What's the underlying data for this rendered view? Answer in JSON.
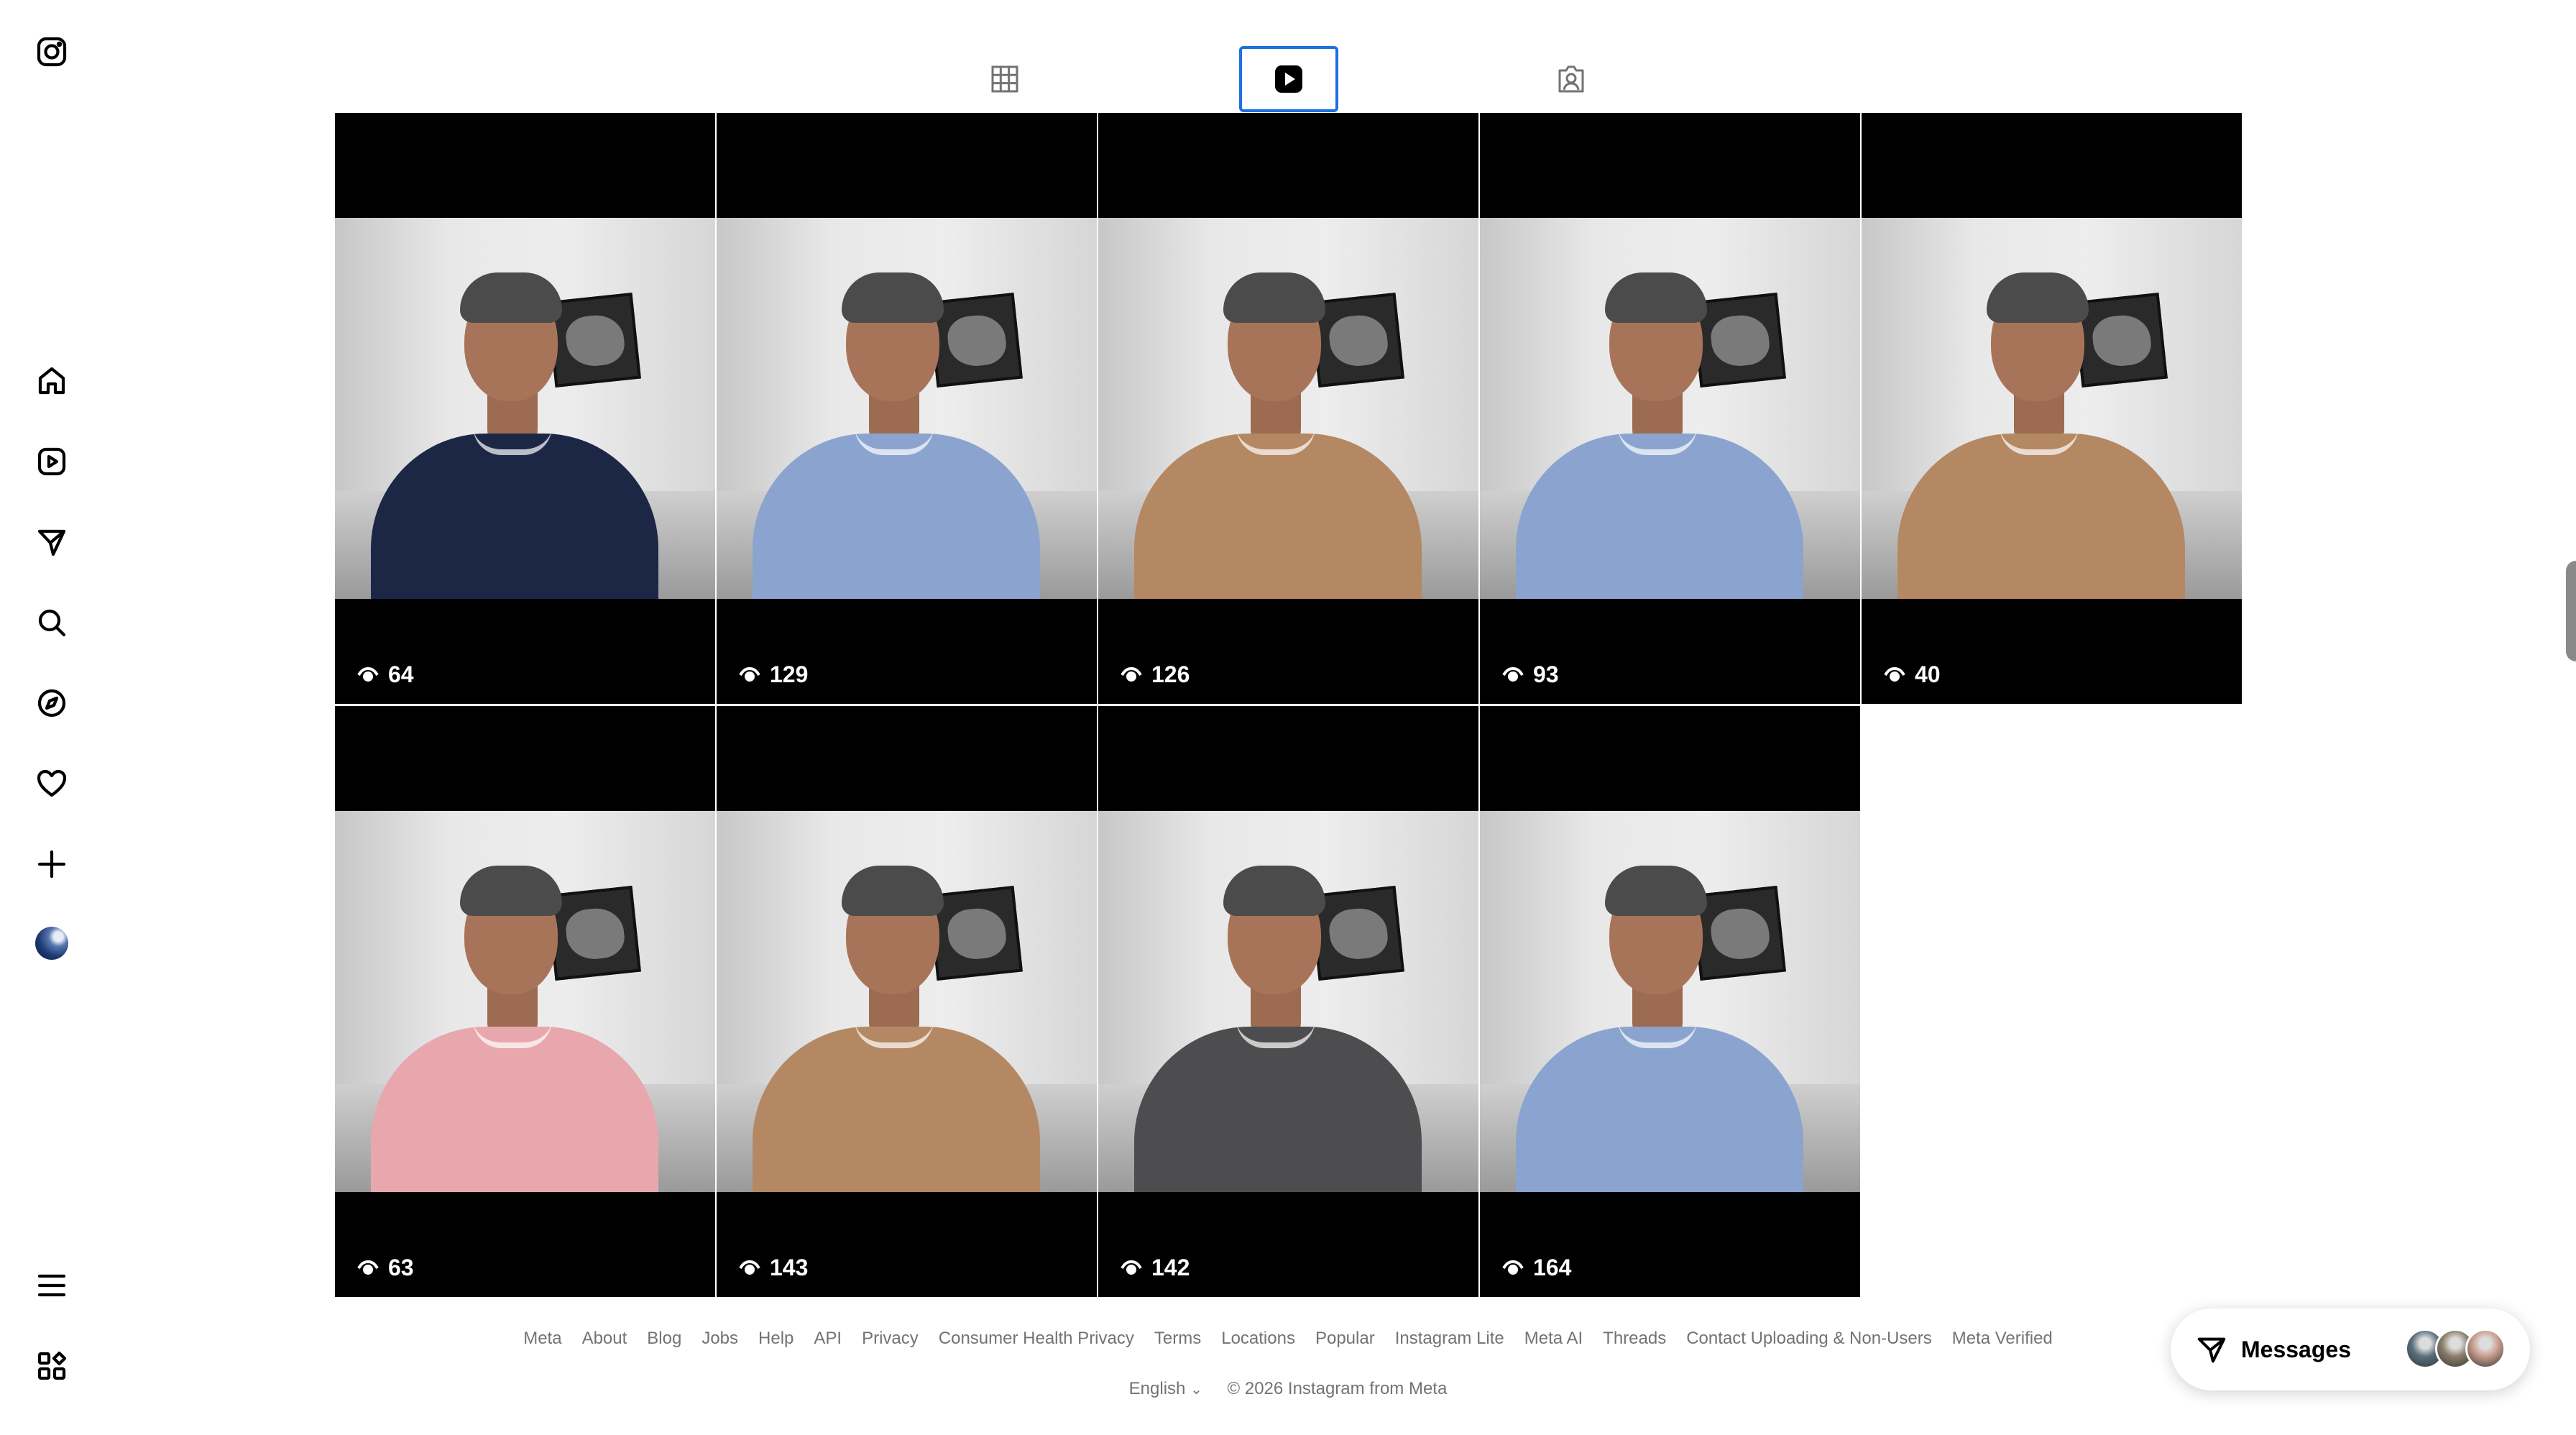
{
  "rail": {
    "items": [
      "instagram-logo",
      "home",
      "reels",
      "messages",
      "search",
      "explore",
      "notifications",
      "create",
      "profile",
      "more",
      "also-from-meta"
    ]
  },
  "tabs": [
    {
      "name": "posts-grid",
      "active": false
    },
    {
      "name": "reels",
      "active": true
    },
    {
      "name": "tagged",
      "active": false
    }
  ],
  "reels": [
    {
      "views": "64",
      "shirt_color": "#1c2746"
    },
    {
      "views": "129",
      "shirt_color": "#8aa4cf"
    },
    {
      "views": "126",
      "shirt_color": "#b48863"
    },
    {
      "views": "93",
      "shirt_color": "#8aa4cf"
    },
    {
      "views": "40",
      "shirt_color": "#b48863"
    },
    {
      "views": "63",
      "shirt_color": "#e8a7ad"
    },
    {
      "views": "143",
      "shirt_color": "#b48863"
    },
    {
      "views": "142",
      "shirt_color": "#4d4d4f"
    },
    {
      "views": "164",
      "shirt_color": "#8aa4cf"
    }
  ],
  "footer": {
    "links": [
      "Meta",
      "About",
      "Blog",
      "Jobs",
      "Help",
      "API",
      "Privacy",
      "Consumer Health Privacy",
      "Terms",
      "Locations",
      "Popular",
      "Instagram Lite",
      "Meta AI",
      "Threads",
      "Contact Uploading & Non-Users",
      "Meta Verified"
    ],
    "language": "English",
    "copyright": "© 2026 Instagram from Meta"
  },
  "messages": {
    "label": "Messages",
    "avatar_colors": [
      "#5a6f7d",
      "#8b7d6b",
      "#c89c8c"
    ]
  },
  "colors": {
    "accent": "#1f6fde",
    "footer_text": "#737373"
  }
}
